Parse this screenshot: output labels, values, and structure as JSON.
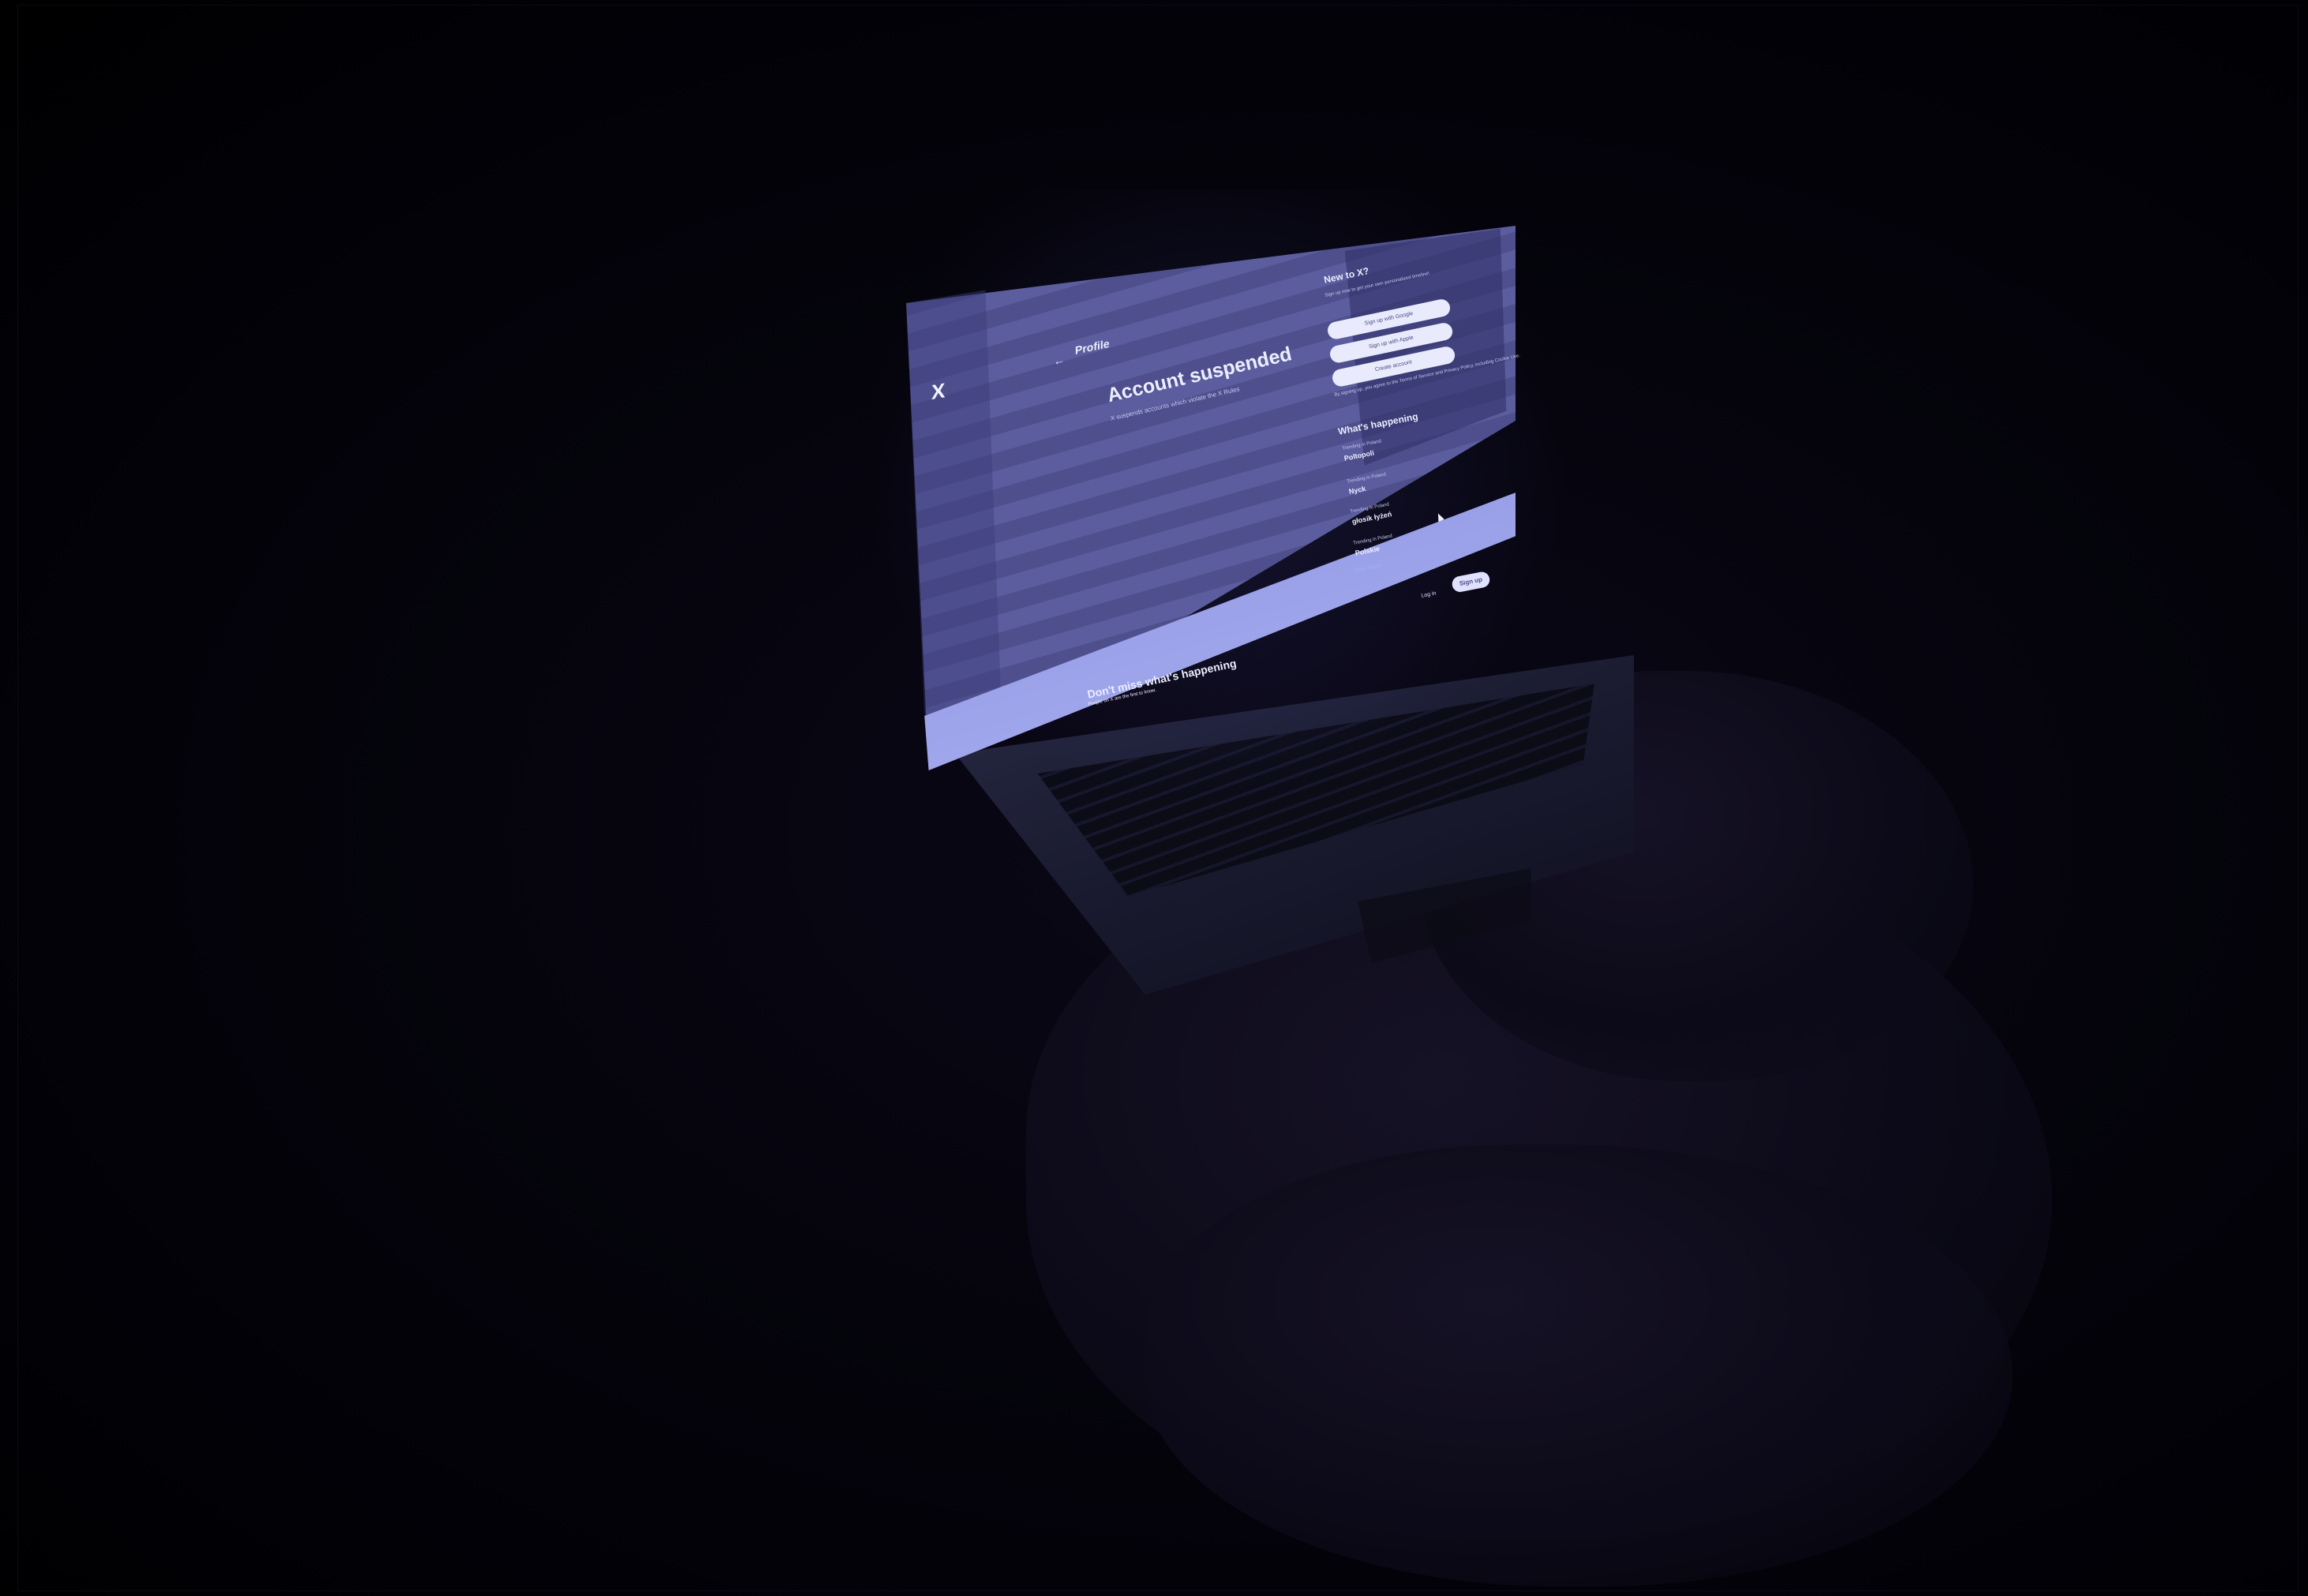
{
  "screen": {
    "logo": "X",
    "header": {
      "back_arrow": "←",
      "title": "Profile"
    },
    "main": {
      "title": "Account suspended",
      "subtitle": "X suspends accounts which violate the X Rules"
    },
    "sidebar": {
      "heading": "New to X?",
      "subheading": "Sign up now to get your own personalized timeline!",
      "buttons": [
        "Sign up with Google",
        "Sign up with Apple",
        "Create account"
      ],
      "terms": "By signing up, you agree to the Terms of Service and Privacy Policy, including Cookie Use."
    },
    "trends": {
      "heading": "What's happening",
      "items": [
        {
          "meta": "Trending in Poland",
          "name": "Poltopoli"
        },
        {
          "meta": "Trending in Poland",
          "name": "Nyck"
        },
        {
          "meta": "Trending in Poland",
          "name": "głosik łyżeń"
        },
        {
          "meta": "Trending in Poland",
          "name": "Polskie"
        }
      ],
      "show_more": "Show more"
    },
    "footer_actions": {
      "login": "Log in",
      "signup": "Sign up"
    },
    "banner": {
      "title": "Don't miss what's happening",
      "subtitle": "People on X are the first to know."
    }
  },
  "colors": {
    "screen_primary": "#4e4f8c",
    "screen_stripe": "#5c5d9e",
    "banner": "#aab0f2",
    "background": "#000000"
  }
}
